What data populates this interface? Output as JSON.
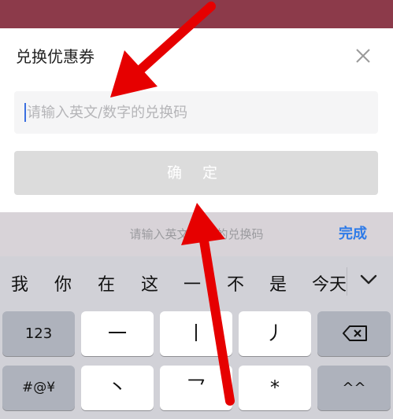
{
  "dialog": {
    "title": "兑换优惠券",
    "close_icon": "close-icon",
    "input": {
      "placeholder": "请输入英文/数字的兑换码",
      "value": ""
    },
    "confirm_label": "确 定"
  },
  "ime_bar": {
    "hint": "请输入英文/数字的兑换码",
    "done_label": "完成"
  },
  "keyboard": {
    "candidates": [
      "我",
      "你",
      "在",
      "这",
      "一",
      "不",
      "是",
      "今天"
    ],
    "expand_icon": "chevron-down-icon",
    "keys": {
      "num_label": "123",
      "k1": "一",
      "k2": "丨",
      "k3": "丿",
      "symbol_label": "#@¥",
      "k4": "丶",
      "k5": "乛",
      "k6": "*",
      "k7": "^^",
      "delete_icon": "backspace-icon"
    }
  },
  "colors": {
    "accent": "#2e7be8",
    "arrow": "#e60000",
    "caret": "#3b6fe0"
  }
}
